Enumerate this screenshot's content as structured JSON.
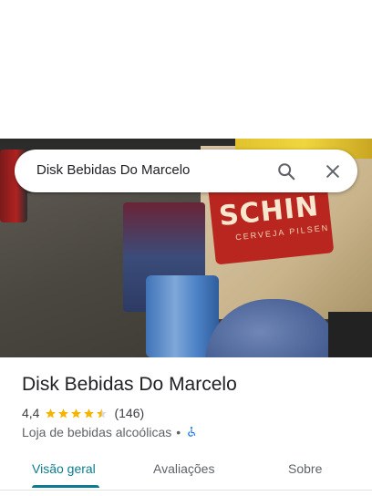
{
  "search": {
    "query": "Disk Bebidas Do Marcelo"
  },
  "place": {
    "name": "Disk Bebidas Do Marcelo",
    "rating": "4,4",
    "rating_value": 4.4,
    "review_count": "(146)",
    "category": "Loja de bebidas alcoólicas",
    "separator": "•",
    "accessibility_icon": "wheelchair-icon"
  },
  "photo": {
    "sign_text": "SCHIN",
    "sign_subtext": "CERVEJA PILSEN"
  },
  "tabs": [
    {
      "label": "Visão geral",
      "active": true
    },
    {
      "label": "Avaliações",
      "active": false
    },
    {
      "label": "Sobre",
      "active": false
    }
  ],
  "colors": {
    "accent": "#0b7c8f",
    "star": "#f4b400",
    "accessibility": "#1a73e8"
  }
}
